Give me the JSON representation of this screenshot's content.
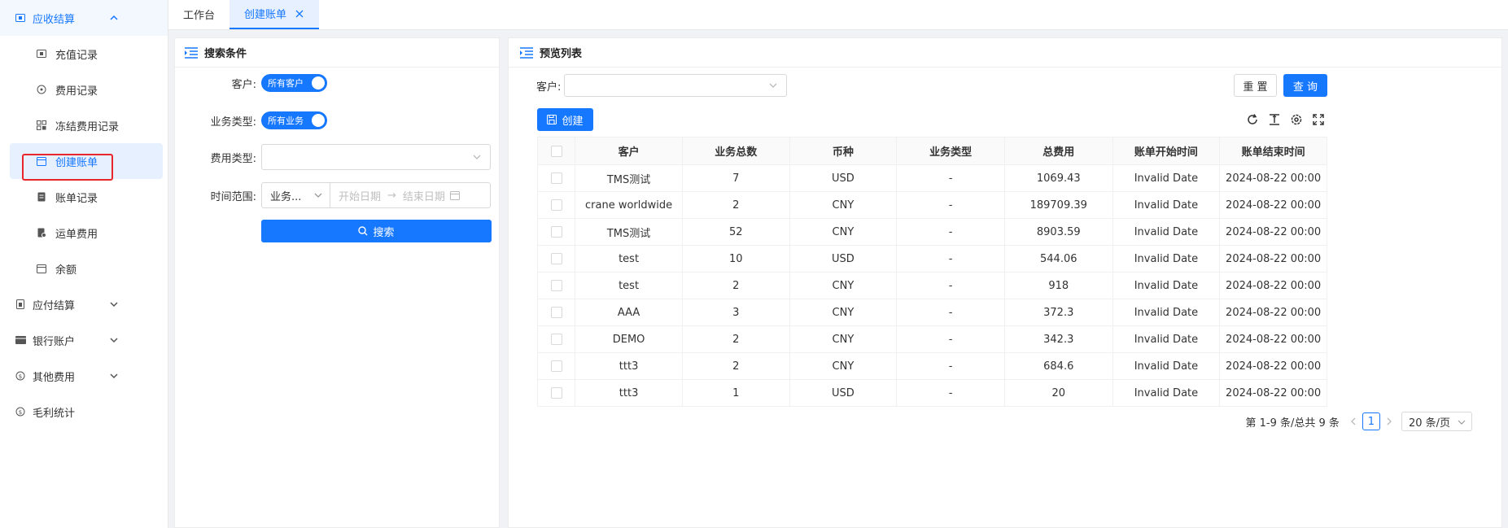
{
  "sidebar": {
    "group_receivable": "应收结算",
    "items": [
      {
        "label": "充值记录"
      },
      {
        "label": "费用记录"
      },
      {
        "label": "冻结费用记录"
      },
      {
        "label": "创建账单"
      },
      {
        "label": "账单记录"
      },
      {
        "label": "运单费用"
      },
      {
        "label": "余额"
      }
    ],
    "group_payable": "应付结算",
    "group_bank": "银行账户",
    "group_other": "其他费用",
    "group_profit": "毛利统计"
  },
  "tabs": [
    {
      "label": "工作台"
    },
    {
      "label": "创建账单"
    }
  ],
  "search_panel": {
    "title": "搜索条件",
    "customer_label": "客户:",
    "customer_toggle": "所有客户",
    "biz_type_label": "业务类型:",
    "biz_type_toggle": "所有业务",
    "fee_type_label": "费用类型:",
    "fee_type_value": "",
    "time_range_label": "时间范围:",
    "time_type_value": "业务...",
    "start_placeholder": "开始日期",
    "range_arrow": "→",
    "end_placeholder": "结束日期",
    "search_button": "搜索"
  },
  "preview_panel": {
    "title": "预览列表",
    "customer_label": "客户:",
    "customer_value": "",
    "reset_button": "重 置",
    "query_button": "查 询",
    "create_button": "创建",
    "columns": [
      "客户",
      "业务总数",
      "币种",
      "业务类型",
      "总费用",
      "账单开始时间",
      "账单结束时间"
    ],
    "rows": [
      [
        "TMS测试",
        "7",
        "USD",
        "-",
        "1069.43",
        "Invalid Date",
        "2024-08-22 00:00"
      ],
      [
        "crane worldwide",
        "2",
        "CNY",
        "-",
        "189709.39",
        "Invalid Date",
        "2024-08-22 00:00"
      ],
      [
        "TMS测试",
        "52",
        "CNY",
        "-",
        "8903.59",
        "Invalid Date",
        "2024-08-22 00:00"
      ],
      [
        "test",
        "10",
        "USD",
        "-",
        "544.06",
        "Invalid Date",
        "2024-08-22 00:00"
      ],
      [
        "test",
        "2",
        "CNY",
        "-",
        "918",
        "Invalid Date",
        "2024-08-22 00:00"
      ],
      [
        "AAA",
        "3",
        "CNY",
        "-",
        "372.3",
        "Invalid Date",
        "2024-08-22 00:00"
      ],
      [
        "DEMO",
        "2",
        "CNY",
        "-",
        "342.3",
        "Invalid Date",
        "2024-08-22 00:00"
      ],
      [
        "ttt3",
        "2",
        "CNY",
        "-",
        "684.6",
        "Invalid Date",
        "2024-08-22 00:00"
      ],
      [
        "ttt3",
        "1",
        "USD",
        "-",
        "20",
        "Invalid Date",
        "2024-08-22 00:00"
      ]
    ],
    "pagination": {
      "summary": "第 1-9 条/总共 9 条",
      "current_page": "1",
      "page_size": "20 条/页"
    }
  },
  "colors": {
    "primary": "#1677ff",
    "highlight_box": "#e8262b"
  }
}
